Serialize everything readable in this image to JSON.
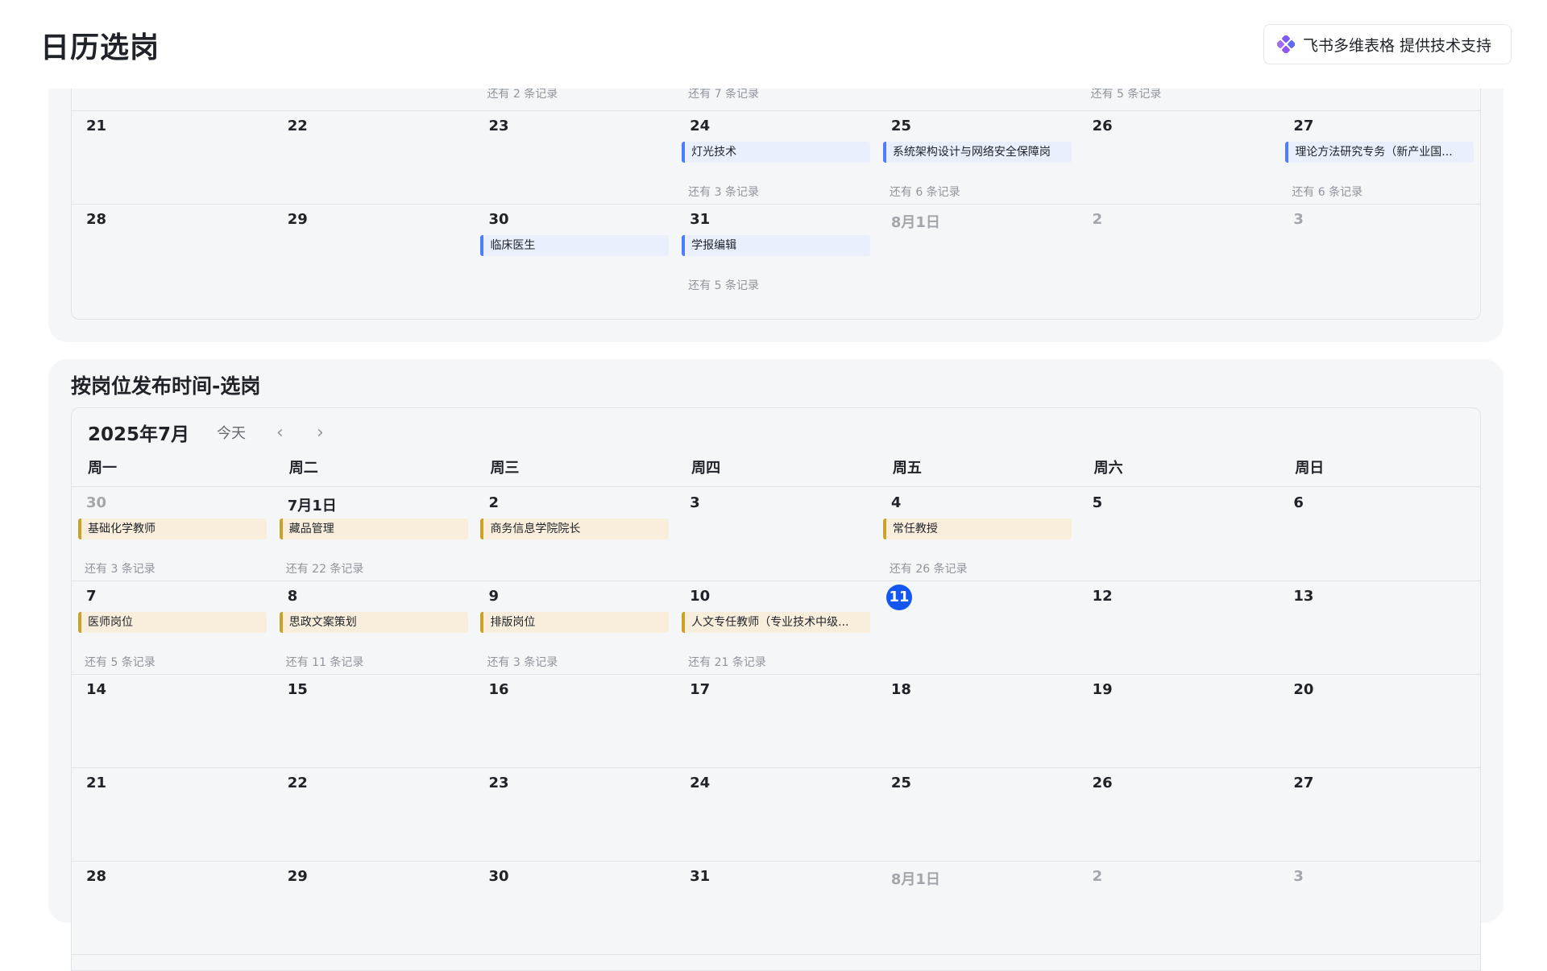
{
  "app": {
    "title": "日历选岗"
  },
  "badge": {
    "text": "飞书多维表格 提供技术支持"
  },
  "calendar_top": {
    "partial_row": [
      {
        "event": "",
        "more": ""
      },
      {
        "event": "",
        "more": ""
      },
      {
        "event": "",
        "more": "还有 2 条记录"
      },
      {
        "event": "",
        "more": "还有 7 条记录"
      },
      {
        "event": "",
        "more": ""
      },
      {
        "event": "",
        "more": "还有 5 条记录"
      },
      {
        "event": "",
        "more": ""
      }
    ],
    "rows": [
      [
        {
          "day": "21",
          "muted": false,
          "event": "",
          "more": ""
        },
        {
          "day": "22",
          "muted": false,
          "event": "",
          "more": ""
        },
        {
          "day": "23",
          "muted": false,
          "event": "",
          "more": ""
        },
        {
          "day": "24",
          "muted": false,
          "event": "灯光技术",
          "more": "还有 3 条记录"
        },
        {
          "day": "25",
          "muted": false,
          "event": "系统架构设计与网络安全保障岗",
          "more": "还有 6 条记录"
        },
        {
          "day": "26",
          "muted": false,
          "event": "",
          "more": ""
        },
        {
          "day": "27",
          "muted": false,
          "event": "理论方法研究专务（新产业国...",
          "more": "还有 6 条记录"
        }
      ],
      [
        {
          "day": "28",
          "muted": false,
          "event": "",
          "more": ""
        },
        {
          "day": "29",
          "muted": false,
          "event": "",
          "more": ""
        },
        {
          "day": "30",
          "muted": false,
          "event": "临床医生",
          "more": ""
        },
        {
          "day": "31",
          "muted": false,
          "event": "学报编辑",
          "more": "还有 5 条记录"
        },
        {
          "day": "8月1日",
          "muted": true,
          "event": "",
          "more": ""
        },
        {
          "day": "2",
          "muted": true,
          "event": "",
          "more": ""
        },
        {
          "day": "3",
          "muted": true,
          "event": "",
          "more": ""
        }
      ]
    ]
  },
  "calendar_bottom": {
    "title": "按岗位发布时间-选岗",
    "month": "2025年7月",
    "today_label": "今天",
    "prev": "‹",
    "next": "›",
    "weekdays": [
      "周一",
      "周二",
      "周三",
      "周四",
      "周五",
      "周六",
      "周日"
    ],
    "rows": [
      [
        {
          "day": "30",
          "muted": true,
          "today": false,
          "event": "基础化学教师",
          "more": "还有 3 条记录"
        },
        {
          "day": "7月1日",
          "muted": false,
          "today": false,
          "event": "藏品管理",
          "more": "还有 22 条记录"
        },
        {
          "day": "2",
          "muted": false,
          "today": false,
          "event": "商务信息学院院长",
          "more": ""
        },
        {
          "day": "3",
          "muted": false,
          "today": false,
          "event": "",
          "more": ""
        },
        {
          "day": "4",
          "muted": false,
          "today": false,
          "event": "常任教授",
          "more": "还有 26 条记录"
        },
        {
          "day": "5",
          "muted": false,
          "today": false,
          "event": "",
          "more": ""
        },
        {
          "day": "6",
          "muted": false,
          "today": false,
          "event": "",
          "more": ""
        }
      ],
      [
        {
          "day": "7",
          "muted": false,
          "today": false,
          "event": "医师岗位",
          "more": "还有 5 条记录"
        },
        {
          "day": "8",
          "muted": false,
          "today": false,
          "event": "思政文案策划",
          "more": "还有 11 条记录"
        },
        {
          "day": "9",
          "muted": false,
          "today": false,
          "event": "排版岗位",
          "more": "还有 3 条记录"
        },
        {
          "day": "10",
          "muted": false,
          "today": false,
          "event": "人文专任教师（专业技术中级...",
          "more": "还有 21 条记录"
        },
        {
          "day": "11",
          "muted": false,
          "today": true,
          "event": "",
          "more": ""
        },
        {
          "day": "12",
          "muted": false,
          "today": false,
          "event": "",
          "more": ""
        },
        {
          "day": "13",
          "muted": false,
          "today": false,
          "event": "",
          "more": ""
        }
      ],
      [
        {
          "day": "14",
          "muted": false,
          "today": false,
          "event": "",
          "more": ""
        },
        {
          "day": "15",
          "muted": false,
          "today": false,
          "event": "",
          "more": ""
        },
        {
          "day": "16",
          "muted": false,
          "today": false,
          "event": "",
          "more": ""
        },
        {
          "day": "17",
          "muted": false,
          "today": false,
          "event": "",
          "more": ""
        },
        {
          "day": "18",
          "muted": false,
          "today": false,
          "event": "",
          "more": ""
        },
        {
          "day": "19",
          "muted": false,
          "today": false,
          "event": "",
          "more": ""
        },
        {
          "day": "20",
          "muted": false,
          "today": false,
          "event": "",
          "more": ""
        }
      ],
      [
        {
          "day": "21",
          "muted": false,
          "today": false,
          "event": "",
          "more": ""
        },
        {
          "day": "22",
          "muted": false,
          "today": false,
          "event": "",
          "more": ""
        },
        {
          "day": "23",
          "muted": false,
          "today": false,
          "event": "",
          "more": ""
        },
        {
          "day": "24",
          "muted": false,
          "today": false,
          "event": "",
          "more": ""
        },
        {
          "day": "25",
          "muted": false,
          "today": false,
          "event": "",
          "more": ""
        },
        {
          "day": "26",
          "muted": false,
          "today": false,
          "event": "",
          "more": ""
        },
        {
          "day": "27",
          "muted": false,
          "today": false,
          "event": "",
          "more": ""
        }
      ],
      [
        {
          "day": "28",
          "muted": false,
          "today": false,
          "event": "",
          "more": ""
        },
        {
          "day": "29",
          "muted": false,
          "today": false,
          "event": "",
          "more": ""
        },
        {
          "day": "30",
          "muted": false,
          "today": false,
          "event": "",
          "more": ""
        },
        {
          "day": "31",
          "muted": false,
          "today": false,
          "event": "",
          "more": ""
        },
        {
          "day": "8月1日",
          "muted": true,
          "today": false,
          "event": "",
          "more": ""
        },
        {
          "day": "2",
          "muted": true,
          "today": false,
          "event": "",
          "more": ""
        },
        {
          "day": "3",
          "muted": true,
          "today": false,
          "event": "",
          "more": ""
        }
      ]
    ]
  },
  "colors": {
    "event_blue_bar": "#4d7cff",
    "event_blue_bg": "#e9effc",
    "event_gold_bar": "#c9a227",
    "event_gold_bg": "#f9eedb",
    "today_circle": "#1456f0",
    "card_bg": "#f5f6f7"
  },
  "icons": {
    "badge_logo": "feishu-bitable-logo-icon",
    "prev": "chevron-left-icon",
    "next": "chevron-right-icon"
  }
}
